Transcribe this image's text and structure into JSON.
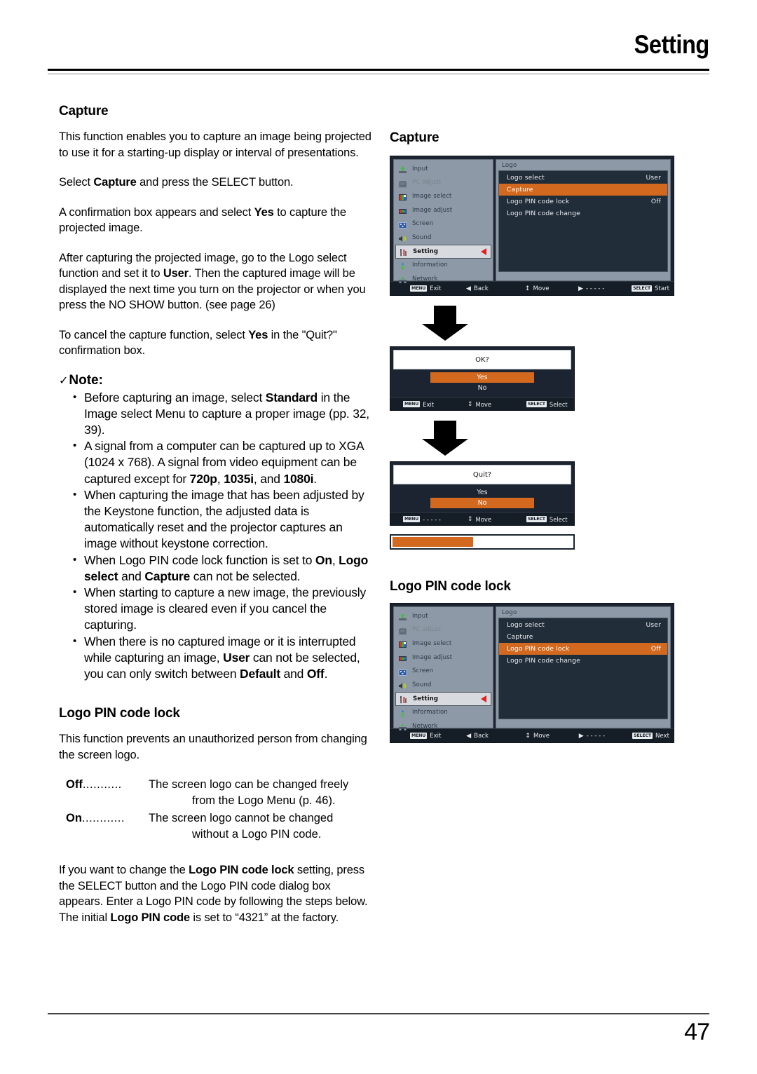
{
  "header": {
    "title": "Setting"
  },
  "footer": {
    "page_number": "47"
  },
  "left": {
    "capture_heading": "Capture",
    "p1": "This function enables you to capture an image being projected to use it for a starting-up display or interval of presentations.",
    "p2a": "Select ",
    "p2b": "Capture",
    "p2c": " and press the SELECT button.",
    "p3a": "A confirmation box appears and select ",
    "p3b": "Yes",
    "p3c": " to capture the projected image.",
    "p4a": "After capturing the projected image, go to the Logo select function and set it to ",
    "p4b": "User",
    "p4c": ". Then the captured image will be displayed the next time you turn on the projector or when you press the NO SHOW button. (see page 26)",
    "p5a": "To cancel the capture function, select ",
    "p5b": "Yes",
    "p5c": " in the \"Quit?\" confirmation box.",
    "note_check": "✓",
    "note_title": "Note:",
    "notes": [
      {
        "a": "Before capturing an image, select ",
        "b": "Standard",
        "c": " in the Image select Menu to capture a proper image (pp. 32, 39)."
      },
      {
        "a": "A signal from a computer can be captured up to XGA (1024 x 768). A signal from video equipment can be captured except for ",
        "b": "720p",
        "c": ", ",
        "b2": "1035i",
        "c2": ", and ",
        "b3": "1080i",
        "c3": "."
      },
      {
        "a": "When capturing the image that has been adjusted by the Keystone function, the adjusted data is automatically reset and the projector captures an image without keystone correction.",
        "b": "",
        "c": ""
      },
      {
        "a": "When Logo PIN code lock function is set to ",
        "b": "On",
        "c": ", ",
        "b2": "Logo select",
        "c2": " and ",
        "b3": "Capture",
        "c3": " can not be selected."
      },
      {
        "a": "When starting to capture a new image, the previously stored image is cleared even if you cancel the capturing.",
        "b": "",
        "c": ""
      },
      {
        "a": "When there is no captured image or it is interrupted while capturing an image, ",
        "b": "User",
        "c": " can not be selected, you can only switch between ",
        "b2": "Default",
        "c2": " and ",
        "b3": "Off",
        "c3": "."
      }
    ],
    "logo_pin_heading": "Logo PIN code lock",
    "p6": "This function prevents an unauthorized person from changing the screen logo.",
    "def_off_term": "Off",
    "def_off_dots": "...........",
    "def_off_desc": "The screen logo can be changed freely",
    "def_off_desc2": "from the Logo Menu (p. 46).",
    "def_on_term": "On",
    "def_on_dots": "............",
    "def_on_desc": "The screen logo cannot be changed",
    "def_on_desc2": "without a Logo PIN code.",
    "p7a": "If you want to change the ",
    "p7b": "Logo PIN code lock",
    "p7c": " setting, press the SELECT button and the Logo PIN code dialog box appears. Enter a Logo PIN code by following the steps below. The initial ",
    "p7d": "Logo PIN code",
    "p7e": " is set to “4321” at the factory."
  },
  "right": {
    "caption_capture": "Capture",
    "caption_logo_pin": "Logo PIN code lock",
    "sidebar_items": [
      {
        "label": "Input",
        "icon": "input-icon",
        "state": "normal"
      },
      {
        "label": "PC adjust",
        "icon": "pc-adjust-icon",
        "state": "dim"
      },
      {
        "label": "Image select",
        "icon": "image-select-icon",
        "state": "normal"
      },
      {
        "label": "Image adjust",
        "icon": "image-adjust-icon",
        "state": "normal"
      },
      {
        "label": "Screen",
        "icon": "screen-icon",
        "state": "normal"
      },
      {
        "label": "Sound",
        "icon": "sound-icon",
        "state": "normal"
      },
      {
        "label": "Setting",
        "icon": "setting-icon",
        "state": "selected"
      },
      {
        "label": "Information",
        "icon": "information-icon",
        "state": "normal"
      },
      {
        "label": "Network",
        "icon": "network-icon",
        "state": "normal"
      }
    ],
    "menu_title": "Logo",
    "menu_rows": [
      {
        "label": "Logo select",
        "value": "User"
      },
      {
        "label": "Capture",
        "value": ""
      },
      {
        "label": "Logo PIN code lock",
        "value": "Off"
      },
      {
        "label": "Logo PIN code change",
        "value": ""
      }
    ],
    "menu1_highlight": 1,
    "menu2_highlight": 2,
    "footbar1": [
      {
        "key": "MENU",
        "glyph": "",
        "label": "Exit"
      },
      {
        "key": "",
        "glyph": "◀",
        "label": "Back"
      },
      {
        "key": "",
        "glyph": "↕",
        "label": "Move"
      },
      {
        "key": "",
        "glyph": "▶",
        "label": "- - - - -"
      },
      {
        "key": "SELECT",
        "glyph": "",
        "label": "Start"
      }
    ],
    "footbar2": [
      {
        "key": "MENU",
        "glyph": "",
        "label": "Exit"
      },
      {
        "key": "",
        "glyph": "◀",
        "label": "Back"
      },
      {
        "key": "",
        "glyph": "↕",
        "label": "Move"
      },
      {
        "key": "",
        "glyph": "▶",
        "label": "- - - - -"
      },
      {
        "key": "SELECT",
        "glyph": "",
        "label": "Next"
      }
    ],
    "dialog_ok": {
      "question": "OK?",
      "yes": "Yes",
      "no": "No",
      "highlight": "yes",
      "foot": [
        {
          "key": "MENU",
          "glyph": "",
          "label": "Exit"
        },
        {
          "key": "",
          "glyph": "↕",
          "label": "Move"
        },
        {
          "key": "SELECT",
          "glyph": "",
          "label": "Select"
        }
      ]
    },
    "dialog_quit": {
      "question": "Quit?",
      "yes": "Yes",
      "no": "No",
      "highlight": "no",
      "foot": [
        {
          "key": "MENU",
          "glyph": "",
          "label": "- - - - -"
        },
        {
          "key": "",
          "glyph": "↕",
          "label": "Move"
        },
        {
          "key": "SELECT",
          "glyph": "",
          "label": "Select"
        }
      ]
    },
    "progress_percent": 45
  },
  "colors": {
    "highlight_orange": "#d2691e",
    "osd_dark": "#222d3a",
    "osd_side_gray": "#8d99a6",
    "arrow_red": "#e02020"
  }
}
